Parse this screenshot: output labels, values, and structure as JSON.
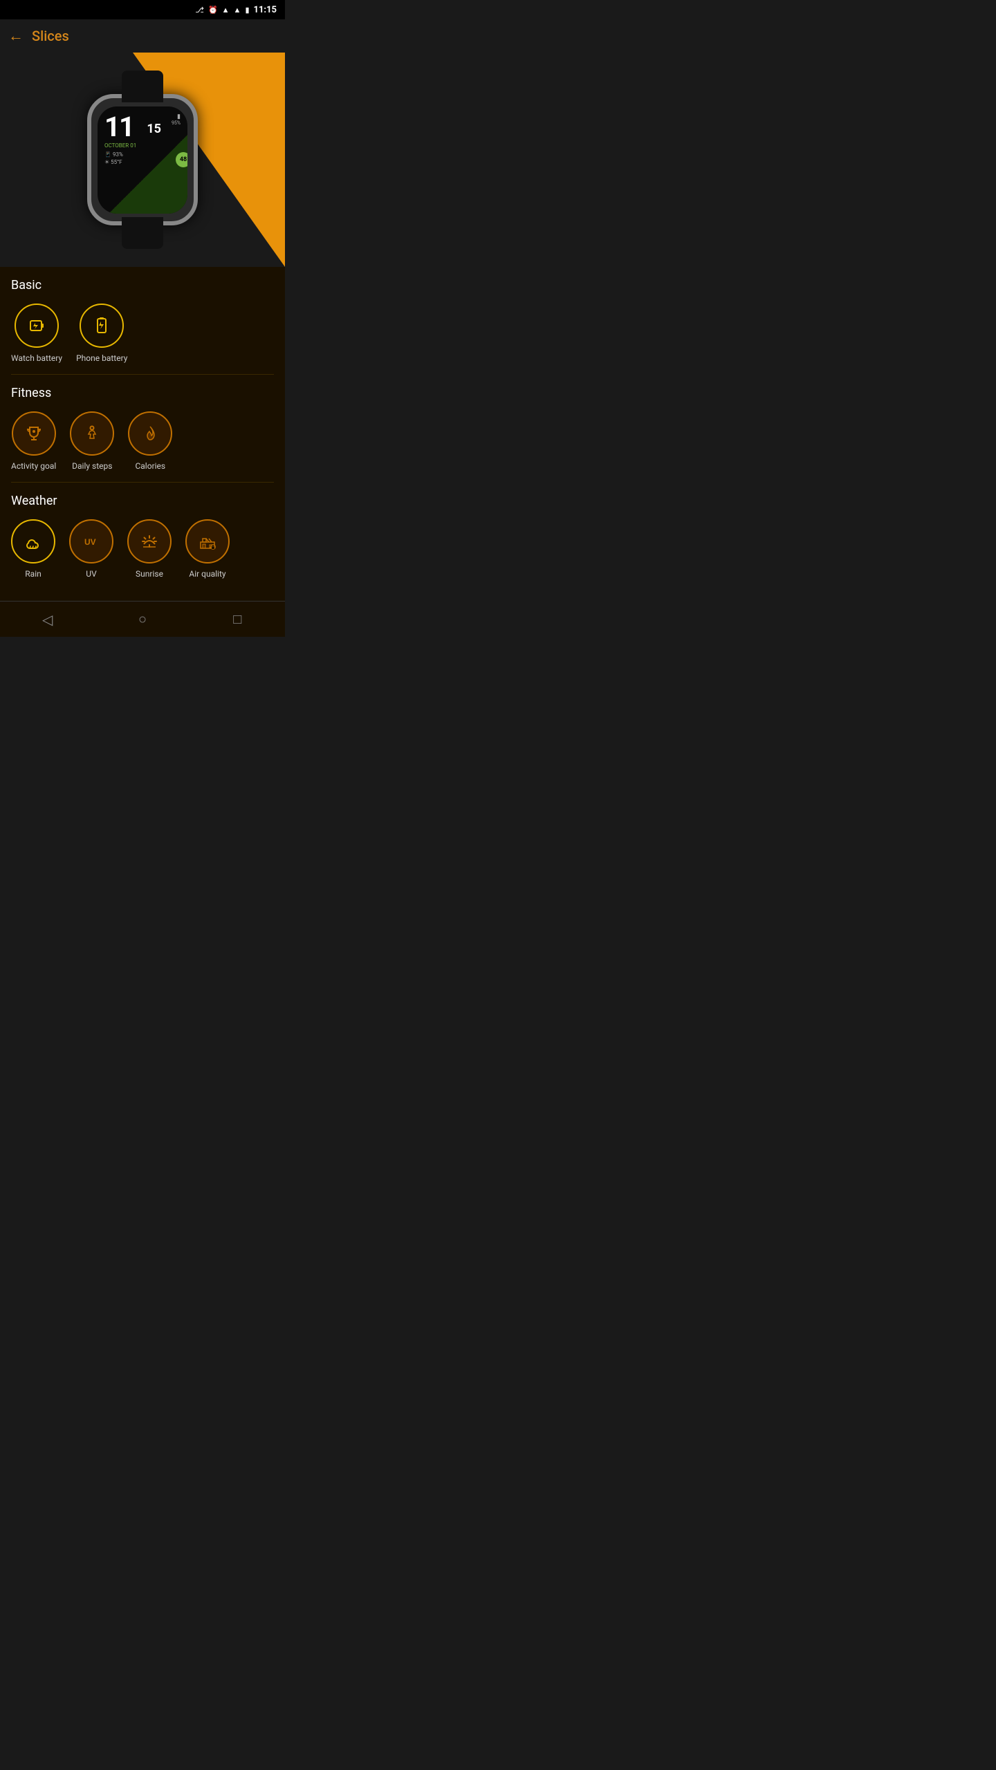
{
  "statusBar": {
    "time": "11:15",
    "icons": [
      "bluetooth",
      "alarm",
      "wifi",
      "signal",
      "battery"
    ]
  },
  "nav": {
    "backLabel": "←",
    "title": "Slices"
  },
  "watch": {
    "timeHour": "11",
    "timeMinute": "15",
    "batteryPercent": "95%",
    "date": "OCTOBER 01",
    "phonePct": "93%",
    "weather": "55°F",
    "badge": "48"
  },
  "sections": {
    "basic": {
      "title": "Basic",
      "items": [
        {
          "id": "watch-battery",
          "label": "Watch battery",
          "icon": "battery-watch"
        },
        {
          "id": "phone-battery",
          "label": "Phone battery",
          "icon": "battery-phone"
        }
      ]
    },
    "fitness": {
      "title": "Fitness",
      "items": [
        {
          "id": "activity-goal",
          "label": "Activity goal",
          "icon": "trophy"
        },
        {
          "id": "daily-steps",
          "label": "Daily steps",
          "icon": "walk"
        },
        {
          "id": "calories",
          "label": "Calories",
          "icon": "flame"
        }
      ]
    },
    "weather": {
      "title": "Weather",
      "items": [
        {
          "id": "rain",
          "label": "Rain",
          "icon": "cloud-rain"
        },
        {
          "id": "uv",
          "label": "UV",
          "icon": "uv"
        },
        {
          "id": "sunrise",
          "label": "Sunrise",
          "icon": "sunrise"
        },
        {
          "id": "air-quality",
          "label": "Air quality",
          "icon": "factory"
        }
      ]
    }
  },
  "bottomNav": {
    "back": "◁",
    "home": "○",
    "recent": "□"
  }
}
